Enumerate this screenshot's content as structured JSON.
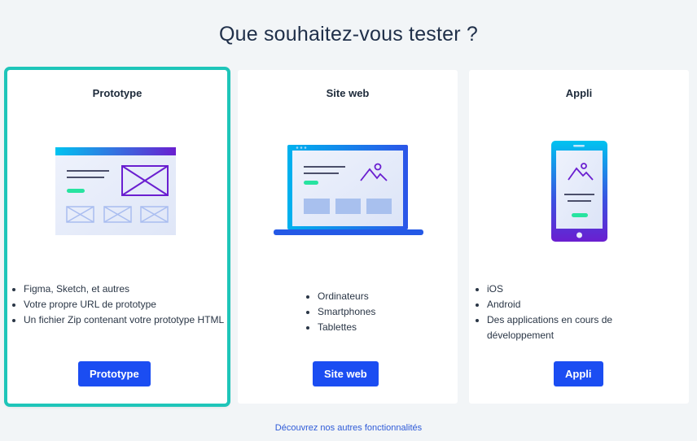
{
  "page": {
    "title": "Que souhaitez-vous tester ?"
  },
  "cards": [
    {
      "title": "Prototype",
      "features": [
        "Figma, Sketch, et autres",
        "Votre propre URL de prototype",
        "Un fichier Zip contenant votre prototype HTML"
      ],
      "button": "Prototype",
      "selected": true
    },
    {
      "title": "Site web",
      "features": [
        "Ordinateurs",
        "Smartphones",
        "Tablettes"
      ],
      "button": "Site web",
      "selected": false
    },
    {
      "title": "Appli",
      "features": [
        "iOS",
        "Android",
        "Des applications en cours de développement"
      ],
      "button": "Appli",
      "selected": false
    }
  ],
  "footer": {
    "link": "Découvrez nos autres fonctionnalités"
  },
  "colors": {
    "accent": "#1b4df2",
    "selection": "#1ec5b9",
    "green": "#27e3a0",
    "purple": "#6a1fd0",
    "cyan": "#00c3f0"
  }
}
